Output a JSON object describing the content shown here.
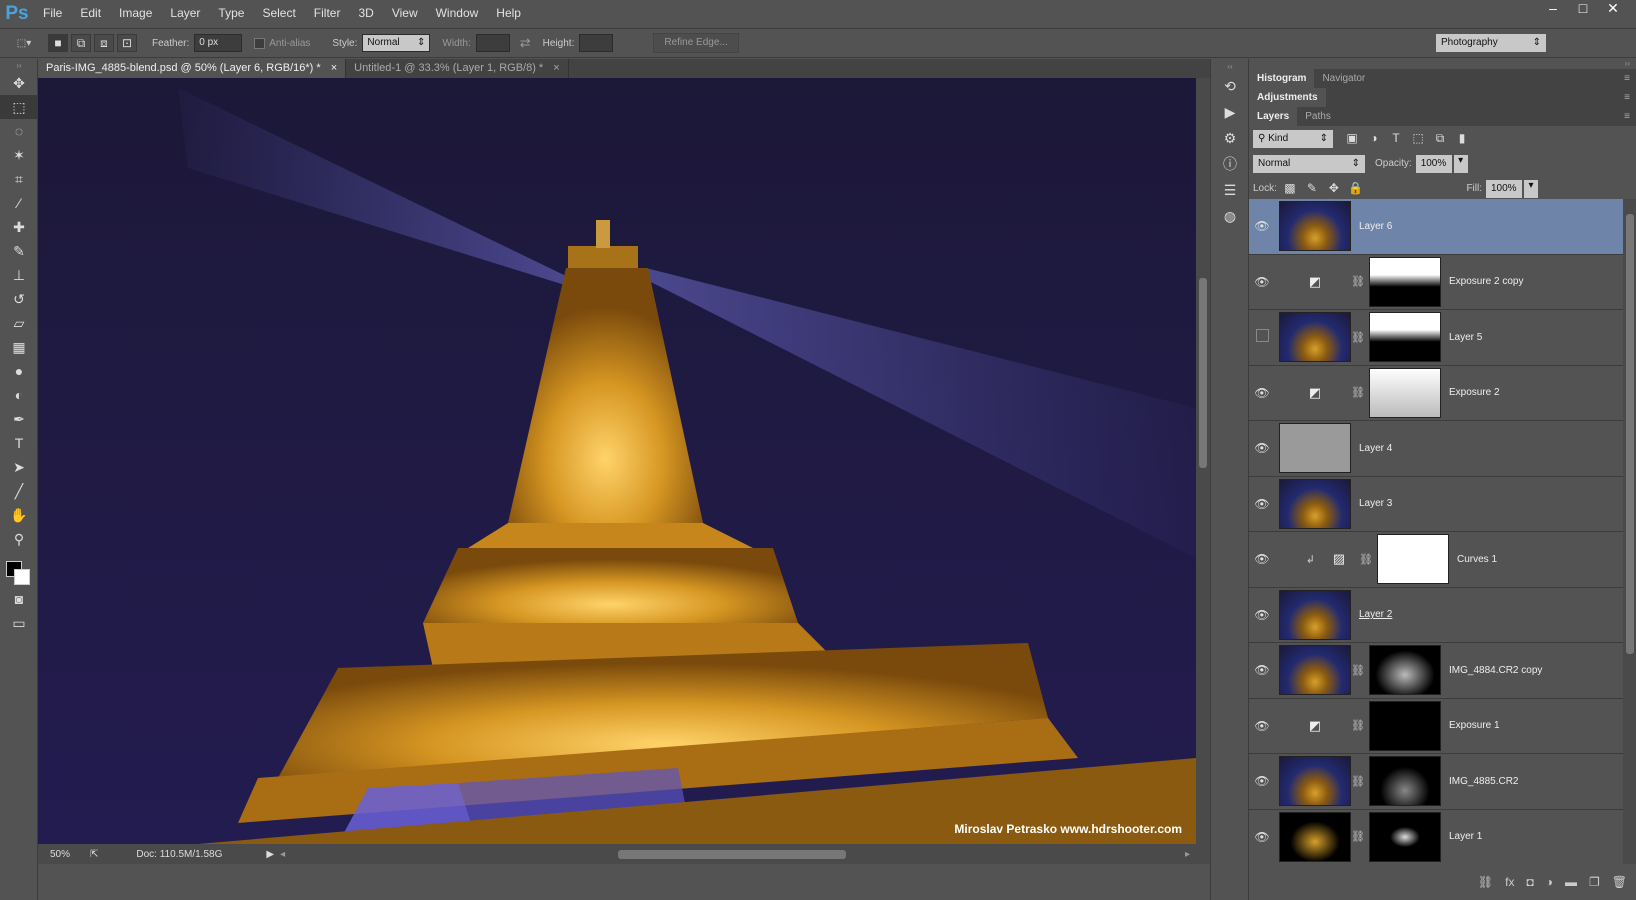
{
  "app": {
    "logo": "Ps"
  },
  "menu": [
    "File",
    "Edit",
    "Image",
    "Layer",
    "Type",
    "Select",
    "Filter",
    "3D",
    "View",
    "Window",
    "Help"
  ],
  "window_controls": [
    "–",
    "□",
    "✕"
  ],
  "options": {
    "feather_label": "Feather:",
    "feather_value": "0 px",
    "antialias_label": "Anti-alias",
    "style_label": "Style:",
    "style_value": "Normal",
    "width_label": "Width:",
    "height_label": "Height:",
    "refine_label": "Refine Edge...",
    "workspace": "Photography"
  },
  "tabs": [
    {
      "label": "Paris-IMG_4885-blend.psd @ 50% (Layer 6, RGB/16*) *",
      "close": "×"
    },
    {
      "label": "Untitled-1 @ 33.3% (Layer 1, RGB/8) *",
      "close": "×"
    }
  ],
  "status": {
    "zoom": "50%",
    "doc": "Doc: 110.5M/1.58G"
  },
  "credit": "Miroslav Petrasko www.hdrshooter.com",
  "panels": {
    "top_tabs": [
      "Histogram",
      "Navigator"
    ],
    "adjustments": "Adjustments",
    "layer_tabs": [
      "Layers",
      "Paths"
    ],
    "filter_kind": "Kind",
    "blend_mode": "Normal",
    "opacity_label": "Opacity:",
    "opacity_value": "100%",
    "lock_label": "Lock:",
    "fill_label": "Fill:",
    "fill_value": "100%"
  },
  "layers": [
    {
      "name": "Layer 6"
    },
    {
      "name": "Exposure 2 copy"
    },
    {
      "name": "Layer 5"
    },
    {
      "name": "Exposure 2"
    },
    {
      "name": "Layer 4"
    },
    {
      "name": "Layer 3"
    },
    {
      "name": "Curves 1"
    },
    {
      "name": "Layer 2"
    },
    {
      "name": "IMG_4884.CR2 copy"
    },
    {
      "name": "Exposure 1"
    },
    {
      "name": "IMG_4885.CR2"
    },
    {
      "name": "Layer 1"
    }
  ]
}
